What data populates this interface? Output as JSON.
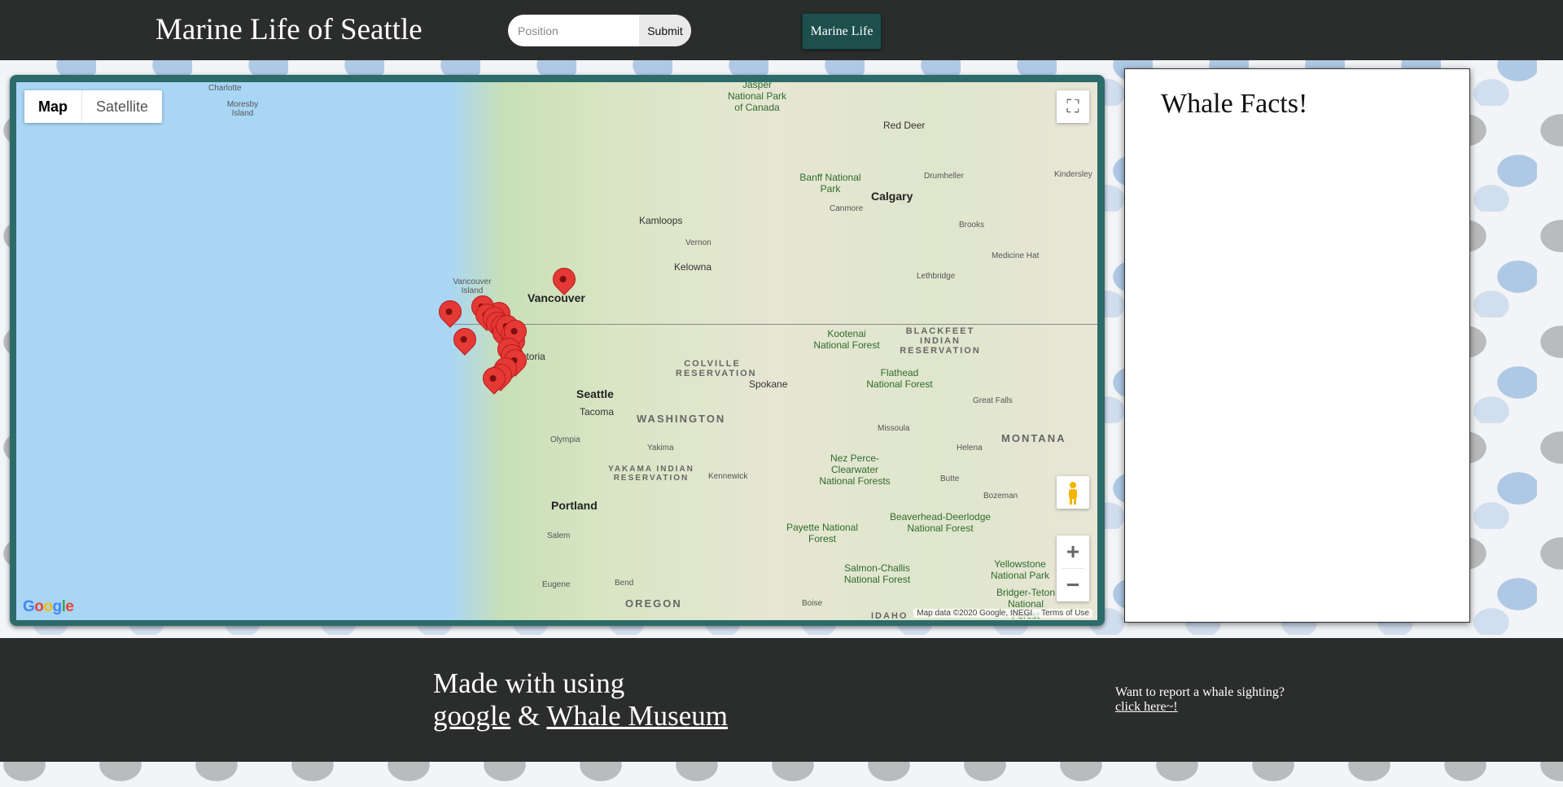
{
  "header": {
    "site_title": "Marine Life of Seattle",
    "search_placeholder": "Position",
    "submit_label": "Submit",
    "nav_label": "Marine Life"
  },
  "map": {
    "map_type_options": [
      "Map",
      "Satellite"
    ],
    "selected_map_type": "Map",
    "google_logo": "Google",
    "attribution": "Map data ©2020 Google, INEGI",
    "terms": "Terms of Use",
    "marker_count": 20,
    "places": {
      "charlotte": "Charlotte",
      "moresby": "Moresby Island",
      "jasper": "Jasper National Park of Canada",
      "red_deer": "Red Deer",
      "drumheller": "Drumheller",
      "kindersley": "Kindersley",
      "banff": "Banff National Park",
      "canmore": "Canmore",
      "calgary": "Calgary",
      "kamloops": "Kamloops",
      "vernon": "Vernon",
      "brooks": "Brooks",
      "kelowna": "Kelowna",
      "medicine_hat": "Medicine Hat",
      "lethbridge": "Lethbridge",
      "vancouver_island": "Vancouver Island",
      "vancouver": "Vancouver",
      "blackfeet": "BLACKFEET INDIAN RESERVATION",
      "kootenai": "Kootenai National Forest",
      "victoria": "Victoria",
      "colville": "COLVILLE RESERVATION",
      "flathead": "Flathead National Forest",
      "spokane": "Spokane",
      "seattle": "Seattle",
      "great_falls": "Great Falls",
      "tacoma": "Tacoma",
      "washington": "WASHINGTON",
      "missoula": "Missoula",
      "montana": "MONTANA",
      "olympia": "Olympia",
      "yakima": "Yakima",
      "helena": "Helena",
      "nez_perce": "Nez Perce-Clearwater National Forests",
      "yakama": "YAKAMA INDIAN RESERVATION",
      "kennewick": "Kennewick",
      "butte": "Butte",
      "portland": "Portland",
      "bozeman": "Bozeman",
      "salem": "Salem",
      "beaverhead": "Beaverhead-Deerlodge National Forest",
      "payette": "Payette National Forest",
      "salmon": "Salmon-Challis National Forest",
      "yellowstone": "Yellowstone National Park",
      "bridger": "Bridger-Teton National Forest",
      "eugene": "Eugene",
      "bend": "Bend",
      "oregon": "OREGON",
      "boise": "Boise",
      "idaho": "IDAHO"
    }
  },
  "facts": {
    "title": "Whale Facts!"
  },
  "footer": {
    "made_with": "Made with",
    "heart_glyph": "",
    "using": "using",
    "google_link": "google",
    "amp": "&",
    "museum_link": "Whale Museum",
    "report_text": "Want to report a whale sighting?",
    "report_link": "click here~!"
  },
  "colors": {
    "header_bg": "#2b2c2c",
    "nav_button_bg": "#1d4f4d",
    "map_frame": "#2c6b69",
    "marker": "#e53935"
  }
}
